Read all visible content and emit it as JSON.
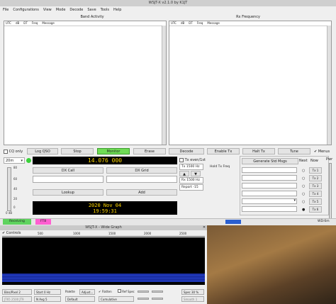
{
  "window": {
    "title": "WSJT-X   v2.1.0   by K1JT",
    "menu": [
      "File",
      "Configurations",
      "View",
      "Mode",
      "Decode",
      "Save",
      "Tools",
      "Help"
    ]
  },
  "band_activity": {
    "title": "Band Activity",
    "columns": [
      "UTC",
      "dB",
      "DT",
      "Freq",
      "Message"
    ]
  },
  "rx_frequency": {
    "title": "Rx Frequency",
    "columns": [
      "UTC",
      "dB",
      "DT",
      "Freq",
      "Message"
    ]
  },
  "controls_row": {
    "cq_only": "CQ only",
    "log_qso": "Log QSO",
    "stop": "Stop",
    "monitor": "Monitor",
    "erase": "Erase",
    "decode": "Decode",
    "enable_tx": "Enable Tx",
    "halt_tx": "Halt Tx",
    "tune": "Tune",
    "menus": "Menus"
  },
  "band": {
    "selected": "20m",
    "frequency": "14.076 000"
  },
  "level_scale": [
    "80",
    "60",
    "40",
    "20",
    "0"
  ],
  "level_unit": "0 dB",
  "call": {
    "dx_call_label": "DX Call",
    "dx_grid_label": "DX Grid",
    "lookup": "Lookup",
    "add": "Add"
  },
  "tx_settings": {
    "tx_even": "Tx even/1st",
    "tx_freq": "Tx 1500  Hz",
    "rx_freq": "Rx 1500  Hz",
    "hold_tx": "Hold Tx Freq",
    "report": "Report -15"
  },
  "clock": {
    "date": "2020 Nov 04",
    "time": "19:59:31"
  },
  "tx_panel": {
    "generate": "Generate Std Msgs",
    "next": "Next",
    "now": "Now",
    "buttons": [
      "Tx 1",
      "Tx 2",
      "Tx 3",
      "Tx 4",
      "Tx 5",
      "Tx 6"
    ],
    "pwr": "Pwr"
  },
  "status": {
    "receiving": "Receiving",
    "mode": "FT8",
    "wd": "WD:6m"
  },
  "wide_graph": {
    "title": "WSJT-X - Wide Graph",
    "controls_label": "Controls",
    "bins": "Bins/Pixel 2",
    "start": "Start 0 Hz",
    "palette": "Palette",
    "adjust": "Adjust...",
    "flatten": "Flatten",
    "ref_spec": "Ref Spec",
    "spec": "Spec 30 %",
    "jt65": "JT65  2500  JT9",
    "navg": "N Avg 5",
    "default": "Default",
    "cumulative": "Cumulative",
    "smooth": "Smooth 1",
    "scale_ticks": [
      "500",
      "1000",
      "1500",
      "2000",
      "2500"
    ]
  },
  "colors": {
    "monitor_green": "#6fdc55",
    "freq_yellow": "#ffd700",
    "receiving_green": "#5fd35f",
    "ft8_pink": "#ff5fd1"
  }
}
